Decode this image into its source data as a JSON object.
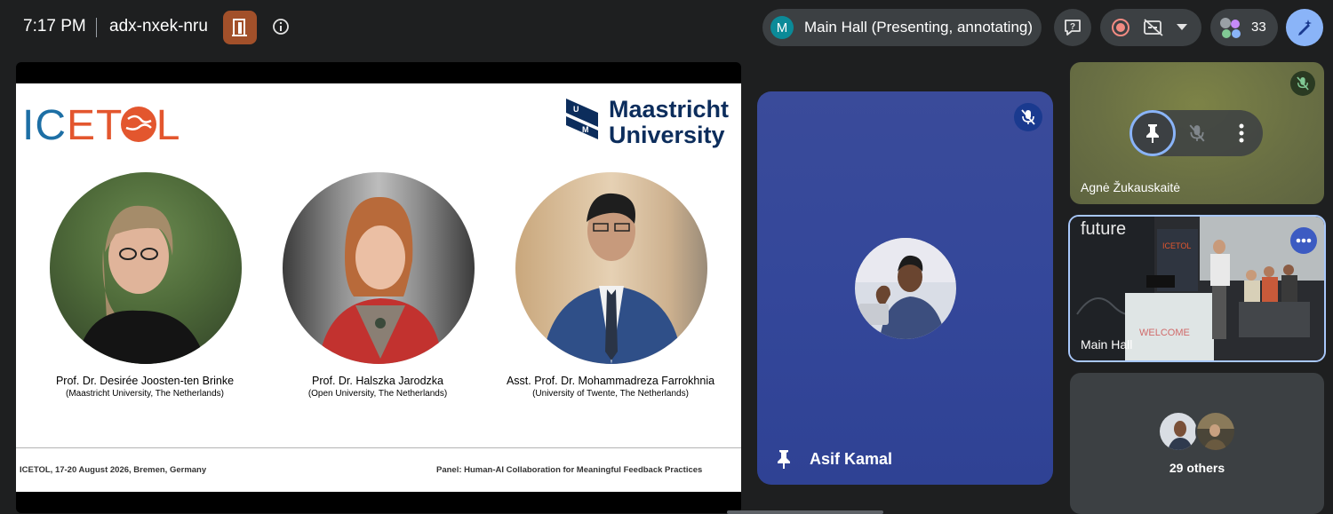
{
  "topbar": {
    "time": "7:17 PM",
    "meeting_code": "adx-nxek-nru",
    "presenter": {
      "avatar_letter": "M",
      "label": "Main Hall (Presenting, annotating)"
    },
    "participant_count": "33"
  },
  "slide": {
    "logo_left_ice": "IC",
    "logo_left_et": "ET",
    "logo_left_ol": "OL",
    "logo_right_line1": "Maastricht",
    "logo_right_line2": "University",
    "panelists": [
      {
        "name": "Prof. Dr. Desirée Joosten-ten Brinke",
        "affiliation": "(Maastricht University, The Netherlands)"
      },
      {
        "name": "Prof. Dr. Halszka Jarodzka",
        "affiliation": "(Open University, The Netherlands)"
      },
      {
        "name": "Asst. Prof. Dr. Mohammadreza Farrokhnia",
        "affiliation": "(University of Twente, The Netherlands)"
      }
    ],
    "footer_left": "ICETOL, 17-20 August 2026, Bremen, Germany",
    "footer_right": "Panel: Human-AI Collaboration for Meaningful Feedback Practices"
  },
  "tiles": {
    "pinned": {
      "name": "Asif Kamal"
    },
    "agne": {
      "name": "Agnė Žukauskaitė"
    },
    "main_hall": {
      "name": "Main Hall",
      "screen_word": "future",
      "welcome_text": "WELCOME"
    },
    "others": {
      "label": "29 others"
    }
  },
  "colors": {
    "accent": "#8ab4f8",
    "record": "#f28b82",
    "presenter_avatar": "#0b8a98",
    "door_button": "#a2502a"
  }
}
